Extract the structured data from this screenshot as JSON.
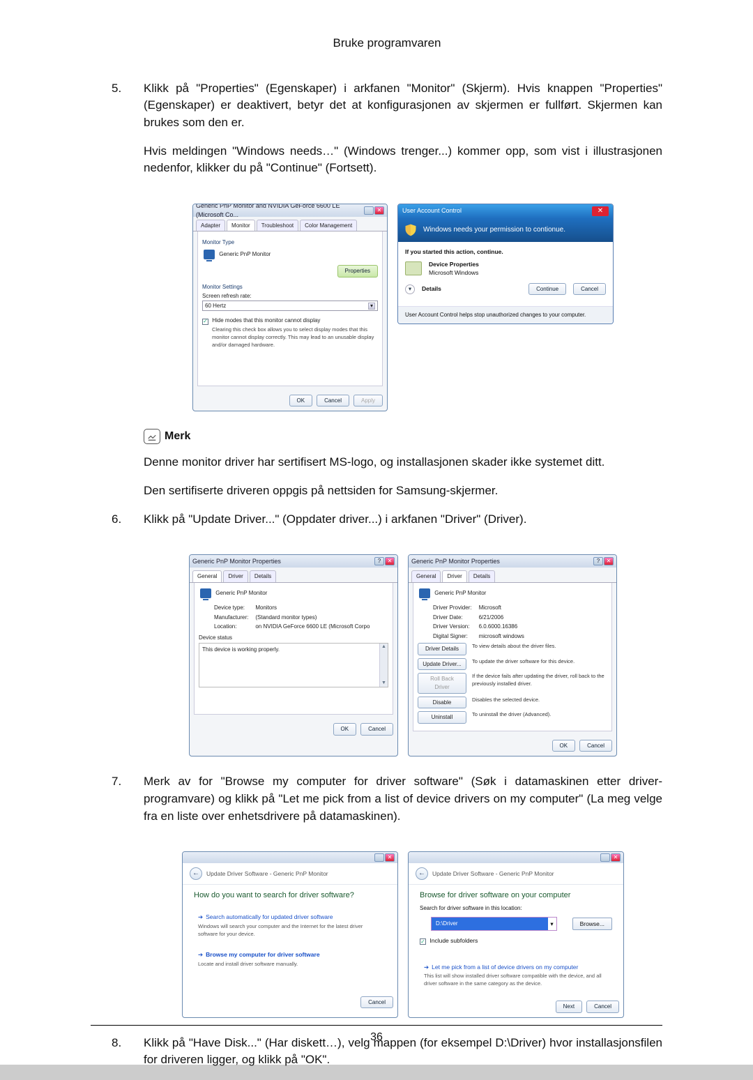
{
  "page": {
    "header": "Bruke programvaren",
    "number": "36"
  },
  "steps": {
    "s5": {
      "num": "5.",
      "p1": "Klikk på \"Properties\" (Egenskaper) i arkfanen \"Monitor\" (Skjerm). Hvis knappen \"Properties\" (Egenskaper) er deaktivert, betyr det at konfigurasjonen av skjermen er fullført. Skjermen kan brukes som den er.",
      "p2": "Hvis meldingen \"Windows needs…\" (Windows trenger...) kommer opp, som vist i illustrasjonen nedenfor, klikker du på \"Continue\" (Fortsett)."
    },
    "s6": {
      "num": "6.",
      "p1": "Klikk på \"Update Driver...\" (Oppdater driver...) i arkfanen \"Driver\" (Driver)."
    },
    "s7": {
      "num": "7.",
      "p1": "Merk av for \"Browse my computer for driver software\" (Søk i datamaskinen etter driver-programvare) og klikk på \"Let me pick from a list of device drivers on my computer\" (La meg velge fra en liste over enhetsdrivere på datamaskinen)."
    },
    "s8": {
      "num": "8.",
      "p1": "Klikk på \"Have Disk...\" (Har diskett…), velg mappen (for eksempel D:\\Driver) hvor installasjonsfilen for driveren ligger, og klikk på \"OK\"."
    }
  },
  "note": {
    "label": "Merk",
    "p1": "Denne monitor driver har sertifisert MS-logo, og installasjonen skader ikke systemet ditt.",
    "p2": "Den sertifiserte driveren oppgis på nettsiden for Samsung-skjermer."
  },
  "f1_monitor": {
    "title": "Generic PnP Monitor and NVIDIA GeForce 6600 LE (Microsoft Co...",
    "tabs": {
      "adapter": "Adapter",
      "monitor": "Monitor",
      "troubleshoot": "Troubleshoot",
      "colormgmt": "Color Management"
    },
    "monitor_type": "Monitor Type",
    "device": "Generic PnP Monitor",
    "properties_btn": "Properties",
    "settings": "Monitor Settings",
    "refresh_label": "Screen refresh rate:",
    "refresh_value": "60 Hertz",
    "hide_modes": "Hide modes that this monitor cannot display",
    "hide_desc": "Clearing this check box allows you to select display modes that this monitor cannot display correctly. This may lead to an unusable display and/or damaged hardware.",
    "ok": "OK",
    "cancel": "Cancel",
    "apply": "Apply"
  },
  "f1_uac": {
    "title": "User Account Control",
    "headline": "Windows needs your permission to contionue.",
    "started": "If you started this action, continue.",
    "prog": "Device Properties",
    "publisher": "Microsoft Windows",
    "details": "Details",
    "continue": "Continue",
    "cancel": "Cancel",
    "footer": "User Account Control helps stop unauthorized changes to your computer."
  },
  "f2_general": {
    "title": "Generic PnP Monitor Properties",
    "tabs": {
      "general": "General",
      "driver": "Driver",
      "details": "Details"
    },
    "device": "Generic PnP Monitor",
    "rows": {
      "type_l": "Device type:",
      "type_v": "Monitors",
      "mfr_l": "Manufacturer:",
      "mfr_v": "(Standard monitor types)",
      "loc_l": "Location:",
      "loc_v": "on NVIDIA GeForce 6600 LE (Microsoft Corpo"
    },
    "status_l": "Device status",
    "status_v": "This device is working properly.",
    "ok": "OK",
    "cancel": "Cancel"
  },
  "f2_driver": {
    "title": "Generic PnP Monitor Properties",
    "device": "Generic PnP Monitor",
    "rows": {
      "prov_l": "Driver Provider:",
      "prov_v": "Microsoft",
      "date_l": "Driver Date:",
      "date_v": "6/21/2006",
      "ver_l": "Driver Version:",
      "ver_v": "6.0.6000.16386",
      "sig_l": "Digital Signer:",
      "sig_v": "microsoft windows"
    },
    "btns": {
      "details": "Driver Details",
      "details_d": "To view details about the driver files.",
      "update": "Update Driver...",
      "update_d": "To update the driver software for this device.",
      "roll": "Roll Back Driver",
      "roll_d": "If the device fails after updating the driver, roll back to the previously installed driver.",
      "disable": "Disable",
      "disable_d": "Disables the selected device.",
      "uninst": "Uninstall",
      "uninst_d": "To uninstall the driver (Advanced)."
    },
    "ok": "OK",
    "cancel": "Cancel"
  },
  "f3_wiz1": {
    "crumb": "Update Driver Software - Generic PnP Monitor",
    "q": "How do you want to search for driver software?",
    "o1t": "Search automatically for updated driver software",
    "o1d": "Windows will search your computer and the Internet for the latest driver software for your device.",
    "o2t": "Browse my computer for driver software",
    "o2d": "Locate and install driver software manually.",
    "cancel": "Cancel"
  },
  "f3_wiz2": {
    "crumb": "Update Driver Software - Generic PnP Monitor",
    "q": "Browse for driver software on your computer",
    "loc_l": "Search for driver software in this location:",
    "path": "D:\\Driver",
    "browse": "Browse...",
    "inc": "Include subfolders",
    "o1t": "Let me pick from a list of device drivers on my computer",
    "o1d": "This list will show installed driver software compatible with the device, and all driver software in the same category as the device.",
    "next": "Next",
    "cancel": "Cancel"
  }
}
